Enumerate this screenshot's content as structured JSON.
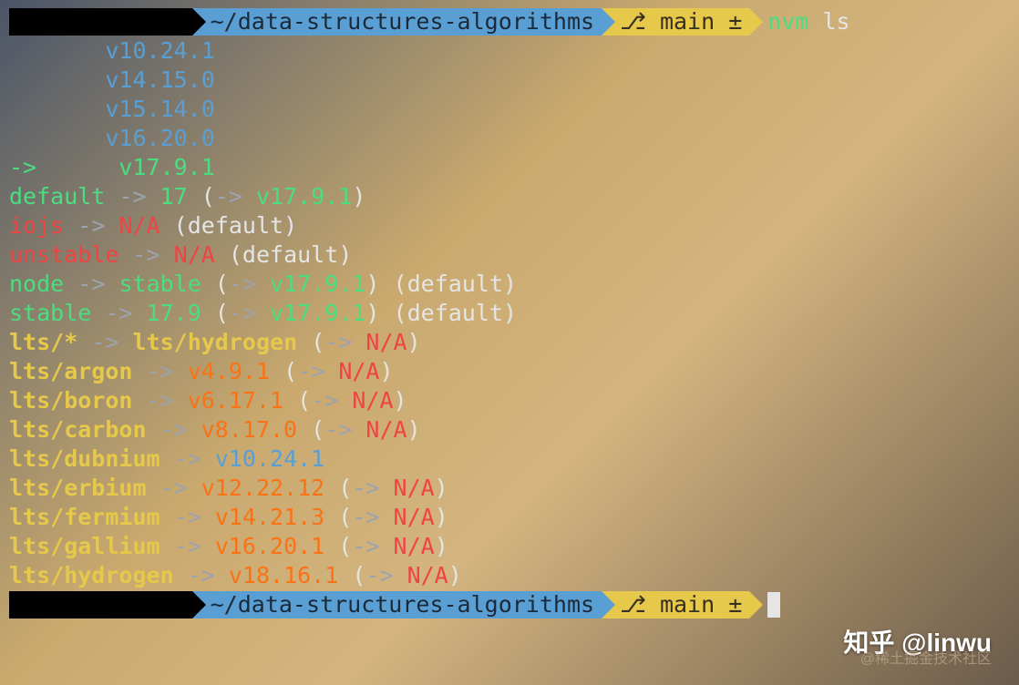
{
  "prompt": {
    "path": "~/data-structures-algorithms",
    "branch_icon": "⎇",
    "branch": "main",
    "dirty": "±"
  },
  "command": {
    "cmd": "nvm",
    "arg": "ls"
  },
  "versions": {
    "v1": "v10.24.1",
    "v2": "v14.15.0",
    "v3": "v15.14.0",
    "v4": "v16.20.0",
    "current_arrow": "->",
    "current": "v17.9.1"
  },
  "aliases": {
    "default_label": "default",
    "default_target": "17",
    "default_resolved": "v17.9.1",
    "iojs_label": "iojs",
    "na": "N/A",
    "default_suffix": "(default)",
    "unstable_label": "unstable",
    "node_label": "node",
    "stable_target": "stable",
    "node_resolved": "v17.9.1",
    "stable_label": "stable",
    "stable_num": "17.9",
    "stable_resolved": "v17.9.1"
  },
  "lts": {
    "star_label": "lts/*",
    "star_target": "lts/hydrogen",
    "argon_label": "lts/argon",
    "argon_ver": "v4.9.1",
    "boron_label": "lts/boron",
    "boron_ver": "v6.17.1",
    "carbon_label": "lts/carbon",
    "carbon_ver": "v8.17.0",
    "dubnium_label": "lts/dubnium",
    "dubnium_ver": "v10.24.1",
    "erbium_label": "lts/erbium",
    "erbium_ver": "v12.22.12",
    "fermium_label": "lts/fermium",
    "fermium_ver": "v14.21.3",
    "gallium_label": "lts/gallium",
    "gallium_ver": "v16.20.1",
    "hydrogen_label": "lts/hydrogen",
    "hydrogen_ver": "v18.16.1"
  },
  "arrow": "->",
  "paren_open": "(",
  "paren_close": ")",
  "watermark": "知乎 @linwu",
  "watermark2": "@稀土掘金技术社区"
}
